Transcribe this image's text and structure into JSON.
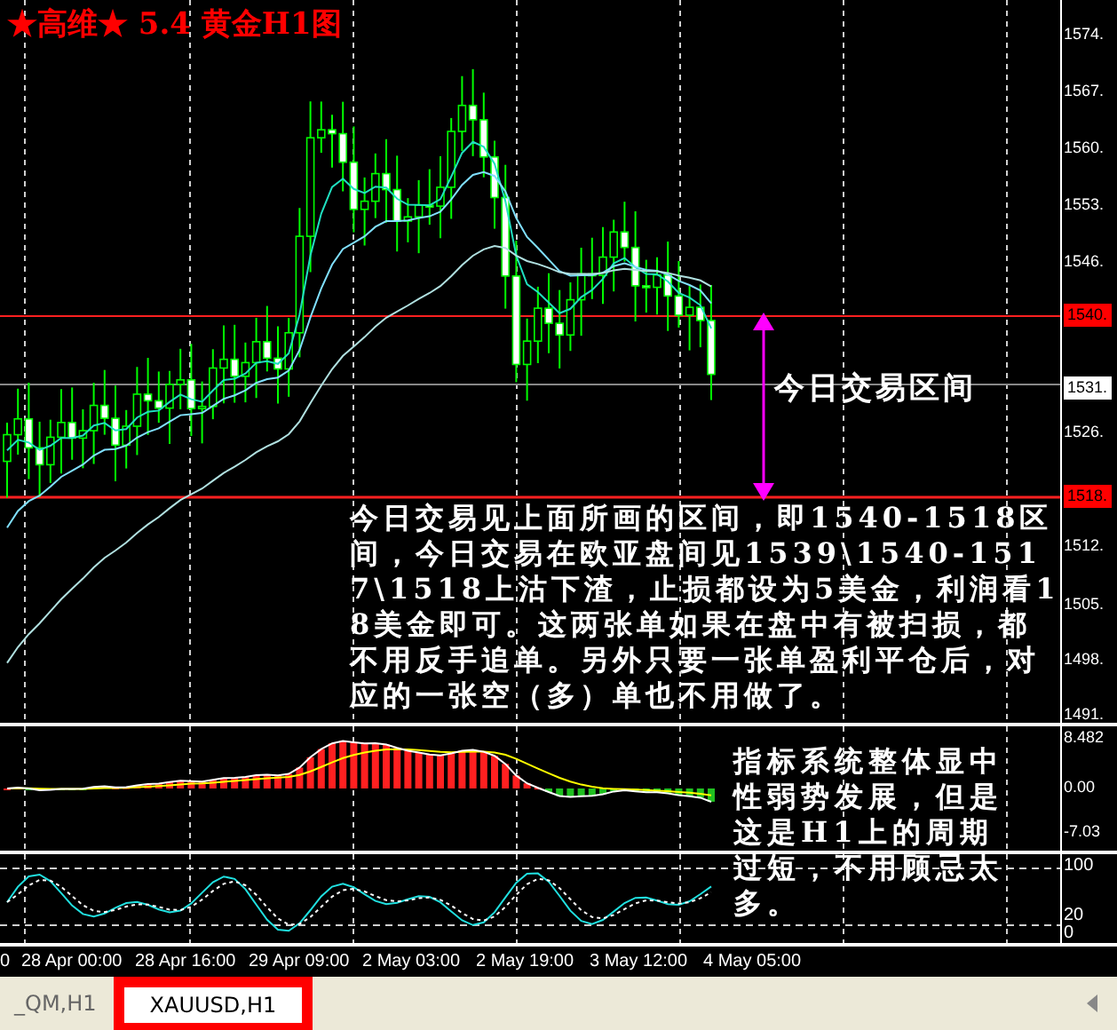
{
  "title": "★高维★ 5.4 黄金H1图",
  "price_axis": [
    {
      "text": "1574.",
      "kind": "tick"
    },
    {
      "text": "1567.",
      "kind": "tick"
    },
    {
      "text": "1560.",
      "kind": "tick"
    },
    {
      "text": "1553.",
      "kind": "tick"
    },
    {
      "text": "1546.",
      "kind": "tick"
    },
    {
      "text": "1540.",
      "kind": "level"
    },
    {
      "text": "1531.",
      "kind": "current"
    },
    {
      "text": "1526.",
      "kind": "tick"
    },
    {
      "text": "1518.",
      "kind": "level"
    },
    {
      "text": "1512.",
      "kind": "tick"
    },
    {
      "text": "1505.",
      "kind": "tick"
    },
    {
      "text": "1498.",
      "kind": "tick"
    },
    {
      "text": "1491.",
      "kind": "tick"
    }
  ],
  "range_label": "今日交易区间",
  "note": "今日交易见上面所画的区间，即1540-1518区间，今日交易在欧亚盘间见1539\\1540-1517\\1518上沽下渣，止损都设为5美金，利润看18美金即可。这两张单如果在盘中有被扫损，都不用反手追单。另外只要一张单盈利平仓后，对应的一张空（多）单也不用做了。",
  "indicator_note": "指标系统整体显中性弱势发展，但是这是H1上的周期过短，不用顾忌太多。",
  "macd_axis": [
    "8.482",
    "0.00",
    "-7.03"
  ],
  "oscillator_axis": [
    "100",
    "20",
    "0"
  ],
  "time_axis": [
    "0",
    "28 Apr 00:00",
    "28 Apr 16:00",
    "29 Apr 09:00",
    "2 May 03:00",
    "2 May 19:00",
    "3 May 12:00",
    "4 May 05:00"
  ],
  "tabs": [
    {
      "label": "_QM,H1",
      "selected": false
    },
    {
      "label": "XAUUSD,H1",
      "selected": true
    }
  ]
}
